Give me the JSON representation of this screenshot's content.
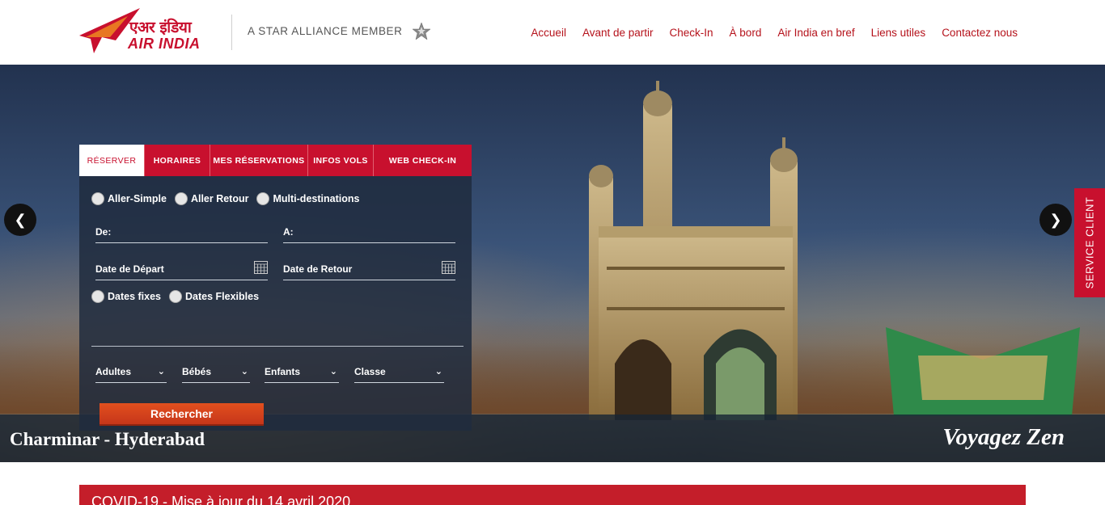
{
  "header": {
    "logo_hindi": "एअर इंडिया",
    "logo_en": "AIR INDIA",
    "star_alliance": "A STAR ALLIANCE MEMBER",
    "nav": [
      "Accueil",
      "Avant de partir",
      "Check-In",
      "À bord",
      "Air India en bref",
      "Liens utiles",
      "Contactez nous"
    ]
  },
  "booking": {
    "tabs": [
      "RÉSERVER",
      "HORAIRES",
      "MES RÉSERVATIONS",
      "INFOS VOLS",
      "WEB CHECK-IN"
    ],
    "trip_types": [
      "Aller-Simple",
      "Aller Retour",
      "Multi-destinations"
    ],
    "from_label": "De:",
    "to_label": "A:",
    "depart_label": "Date de Départ",
    "return_label": "Date de Retour",
    "date_options": [
      "Dates fixes",
      "Dates Flexibles"
    ],
    "adults": "Adultes",
    "infants": "Bébés",
    "children": "Enfants",
    "class": "Classe",
    "search": "Rechercher"
  },
  "hero": {
    "caption_left": "Charminar - Hyderabad",
    "caption_right": "Voyagez Zen",
    "service_tab": "SERVICE CLIENT"
  },
  "covid": {
    "text": "COVID-19 - Mise à jour du 14 avril 2020"
  },
  "colors": {
    "brand_red": "#c8102e",
    "nav_text": "#b5121b"
  }
}
